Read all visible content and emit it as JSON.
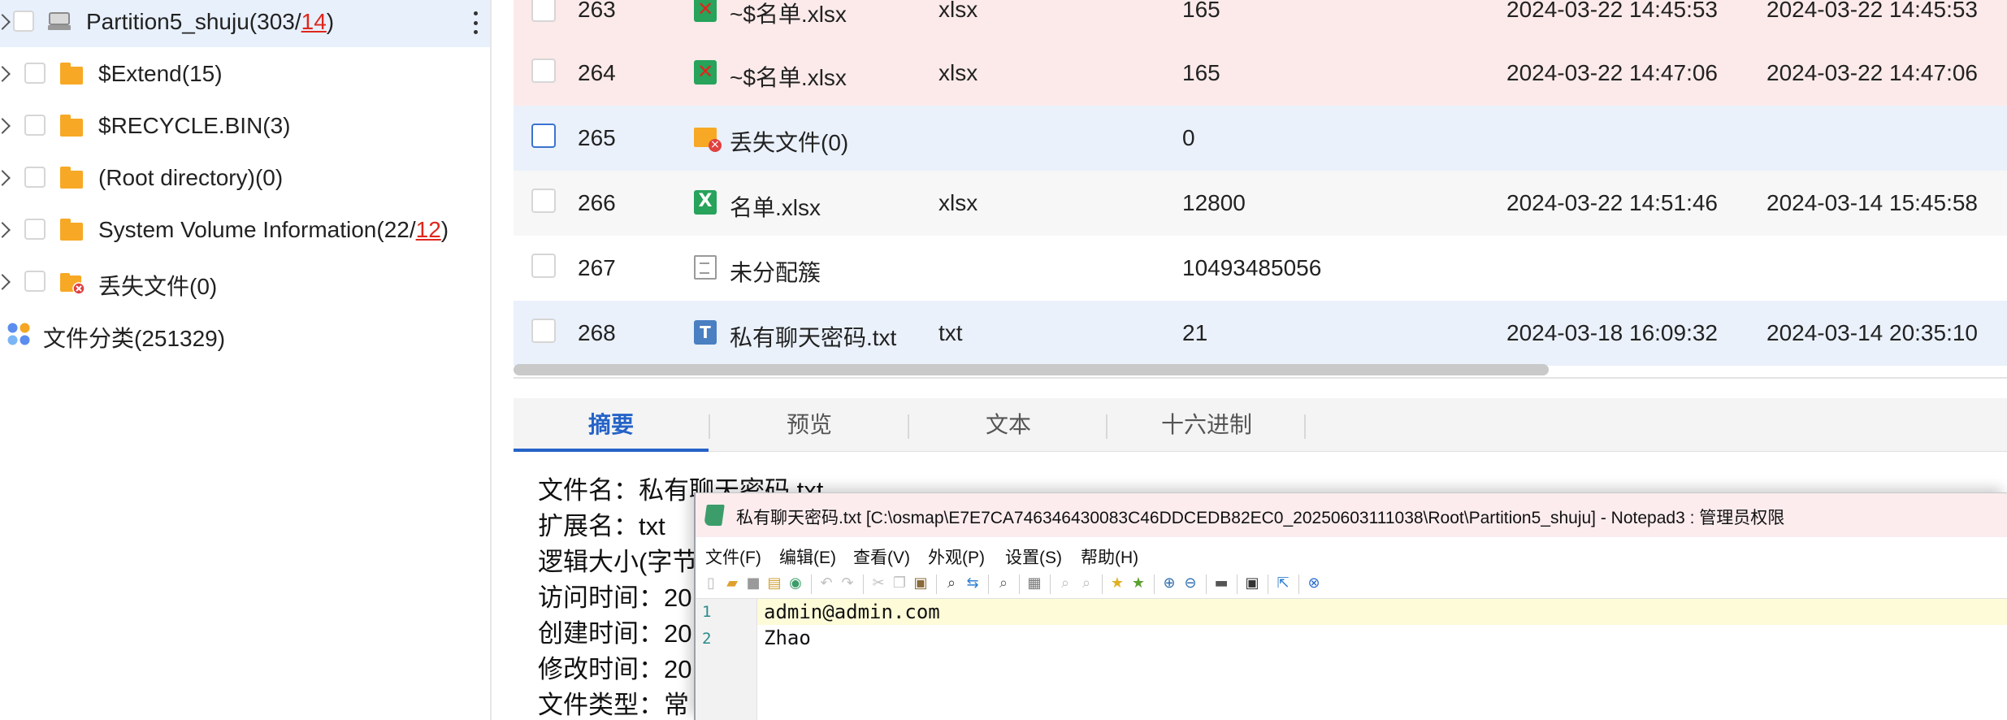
{
  "tree": {
    "items": [
      {
        "label": "Partition5_shuju(303/",
        "red": "14",
        "suffix": ")",
        "icon": "drive-icon",
        "selected": true
      },
      {
        "label": "$Extend(15)",
        "red": "",
        "suffix": "",
        "icon": "folder-icon"
      },
      {
        "label": "$RECYCLE.BIN(3)",
        "red": "",
        "suffix": "",
        "icon": "folder-icon"
      },
      {
        "label": "(Root directory)(0)",
        "red": "",
        "suffix": "",
        "icon": "folder-icon"
      },
      {
        "label": "System Volume Information(22/",
        "red": "12",
        "suffix": ")",
        "icon": "folder-icon"
      },
      {
        "label": "丢失文件(0)",
        "red": "",
        "suffix": "",
        "icon": "lost-folder-icon"
      },
      {
        "label": "文件分类(251329)",
        "red": "",
        "suffix": "",
        "icon": "category-icon"
      }
    ]
  },
  "files": {
    "rows": [
      {
        "index": "263",
        "name": "~$名单.xlsx",
        "ext": "xlsx",
        "size": "165",
        "date1": "2024-03-22 14:45:53",
        "date2": "2024-03-22 14:45:53",
        "icon": "deleted-excel-icon"
      },
      {
        "index": "264",
        "name": "~$名单.xlsx",
        "ext": "xlsx",
        "size": "165",
        "date1": "2024-03-22 14:47:06",
        "date2": "2024-03-22 14:47:06",
        "icon": "deleted-excel-icon"
      },
      {
        "index": "265",
        "name": "丢失文件(0)",
        "ext": "",
        "size": "0",
        "date1": "",
        "date2": "",
        "icon": "lost-folder-icon"
      },
      {
        "index": "266",
        "name": "名单.xlsx",
        "ext": "xlsx",
        "size": "12800",
        "date1": "2024-03-22 14:51:46",
        "date2": "2024-03-14 15:45:58",
        "icon": "excel-icon"
      },
      {
        "index": "267",
        "name": "未分配簇",
        "ext": "",
        "size": "10493485056",
        "date1": "",
        "date2": "",
        "icon": "document-icon"
      },
      {
        "index": "268",
        "name": "私有聊天密码.txt",
        "ext": "txt",
        "size": "21",
        "date1": "2024-03-18 16:09:32",
        "date2": "2024-03-14 20:35:10",
        "icon": "text-file-icon"
      }
    ]
  },
  "tabs": [
    {
      "label": "摘要",
      "active": true
    },
    {
      "label": "预览",
      "active": false
    },
    {
      "label": "文本",
      "active": false
    },
    {
      "label": "十六进制",
      "active": false
    }
  ],
  "summary": {
    "filename": "文件名：私有聊天密码.txt",
    "extension": "扩展名：txt",
    "logical_size": "逻辑大小(字节",
    "access_time": "访问时间：20",
    "create_time": "创建时间：20",
    "modify_time": "修改时间：20",
    "file_type": "文件类型：常"
  },
  "notepad": {
    "title": "私有聊天密码.txt [C:\\osmap\\E7E7CA746346430083C46DDCEDB82EC0_20250603111038\\Root\\Partition5_shuju] - Notepad3 : 管理员权限",
    "menu": [
      "文件(F)",
      "编辑(E)",
      "查看(V)",
      "外观(P)",
      "设置(S)",
      "帮助(H)"
    ],
    "lines": [
      {
        "number": "1",
        "text": "admin@admin.com"
      },
      {
        "number": "2",
        "text": "Zhao"
      }
    ]
  },
  "colors": {
    "accent": "#2563c7",
    "deleted_row": "#fceaea",
    "selected_row": "#eaf1fb",
    "red_count": "#e0261b"
  }
}
